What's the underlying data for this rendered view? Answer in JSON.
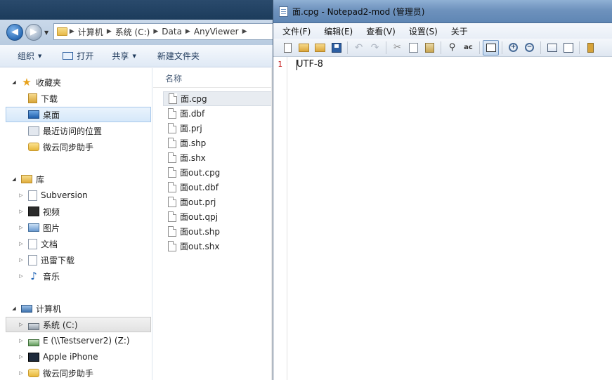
{
  "explorer": {
    "address": {
      "crumbs": [
        "计算机",
        "系统 (C:)",
        "Data",
        "AnyViewer"
      ]
    },
    "commands": {
      "organize": "组织",
      "open": "打开",
      "share": "共享",
      "new_folder": "新建文件夹"
    },
    "nav": {
      "favorites": {
        "label": "收藏夹",
        "items": [
          "下载",
          "桌面",
          "最近访问的位置",
          "微云同步助手"
        ]
      },
      "libraries": {
        "label": "库",
        "items": [
          "Subversion",
          "视频",
          "图片",
          "文档",
          "迅雷下载",
          "音乐"
        ]
      },
      "computer": {
        "label": "计算机",
        "items": [
          "系统 (C:)",
          "E (\\\\Testserver2) (Z:)",
          "Apple iPhone",
          "微云同步助手"
        ]
      }
    },
    "files": {
      "column_name": "名称",
      "items": [
        "面.cpg",
        "面.dbf",
        "面.prj",
        "面.shp",
        "面.shx",
        "面out.cpg",
        "面out.dbf",
        "面out.prj",
        "面out.qpj",
        "面out.shp",
        "面out.shx"
      ]
    }
  },
  "notepad": {
    "title": "面.cpg - Notepad2-mod (管理员)",
    "menu": [
      "文件(F)",
      "编辑(E)",
      "查看(V)",
      "设置(S)",
      "关于"
    ],
    "toolbar_icons": [
      "new-icon",
      "open-icon",
      "browse-icon",
      "save-icon",
      "undo-icon",
      "redo-icon",
      "cut-icon",
      "copy-icon",
      "paste-icon",
      "find-icon",
      "replace-icon",
      "word-wrap-icon",
      "zoom-in-icon",
      "zoom-out-icon",
      "scheme-icon",
      "customize-scheme-icon",
      "exit-icon"
    ],
    "editor": {
      "line_number": "1",
      "line_text": "UTF-8"
    }
  }
}
